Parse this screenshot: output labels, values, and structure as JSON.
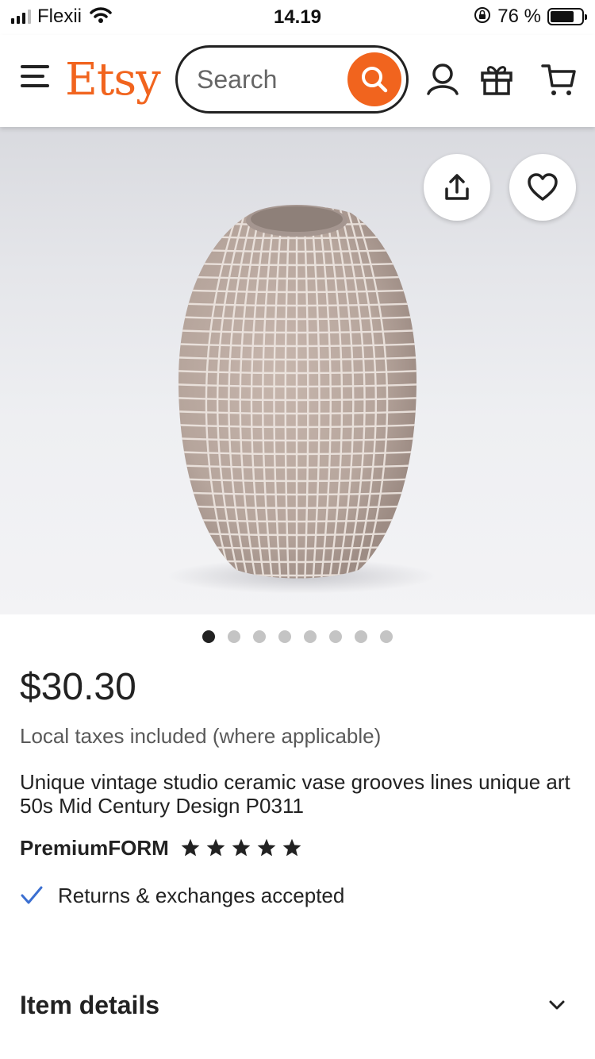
{
  "status_bar": {
    "carrier": "Flexii",
    "time": "14.19",
    "battery_percent": "76 %",
    "battery_level": 0.76,
    "signal_bars": 3
  },
  "header": {
    "logo": "Etsy",
    "search_placeholder": "Search",
    "icons": [
      "menu-icon",
      "search-icon",
      "user-icon",
      "gift-icon",
      "cart-icon"
    ]
  },
  "product": {
    "image_icons": [
      "share-icon",
      "heart-icon"
    ],
    "image_count": 8,
    "active_image_index": 0,
    "price": "$30.30",
    "taxes_note": "Local taxes included (where applicable)",
    "title": "Unique vintage studio ceramic vase grooves lines unique art 50s Mid Century Design P0311",
    "seller": "PremiumFORM",
    "rating_stars": 5,
    "returns": "Returns & exchanges accepted"
  },
  "details": {
    "heading": "Item details"
  },
  "colors": {
    "brand": "#F1641E",
    "text": "#222222",
    "muted": "#595959",
    "check": "#3B6FD1"
  }
}
